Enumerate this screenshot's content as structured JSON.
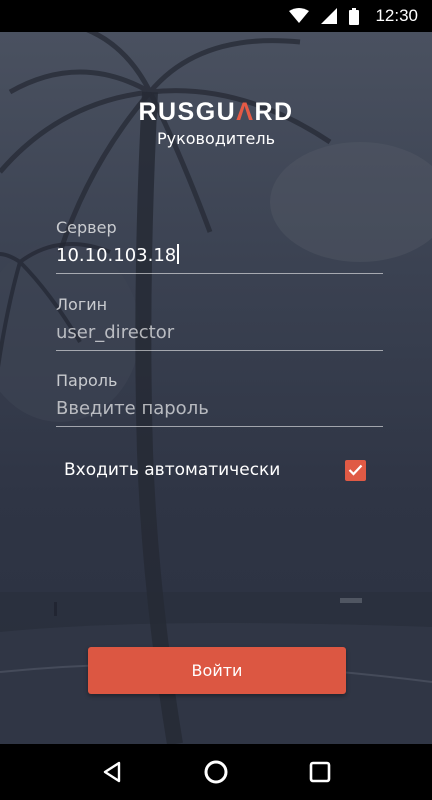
{
  "status_bar": {
    "time": "12:30"
  },
  "logo": {
    "text_before": "RUSGU",
    "text_accent": "Λ",
    "text_after": "RD"
  },
  "subtitle": "Руководитель",
  "form": {
    "server": {
      "label": "Сервер",
      "value": "10.10.103.18"
    },
    "login": {
      "label": "Логин",
      "value": "user_director"
    },
    "password": {
      "label": "Пароль",
      "placeholder": "Введите пароль",
      "value": ""
    }
  },
  "auto_login": {
    "label": "Входить автоматически",
    "checked": true
  },
  "login_button": {
    "label": "Войти"
  },
  "colors": {
    "accent": "#dc5742",
    "background": "#2b3140"
  },
  "icons": {
    "nav_back": "back-triangle-icon",
    "nav_home": "home-circle-icon",
    "nav_recents": "recents-square-icon",
    "status_wifi": "wifi-icon",
    "status_signal": "signal-icon",
    "status_battery": "battery-icon"
  }
}
